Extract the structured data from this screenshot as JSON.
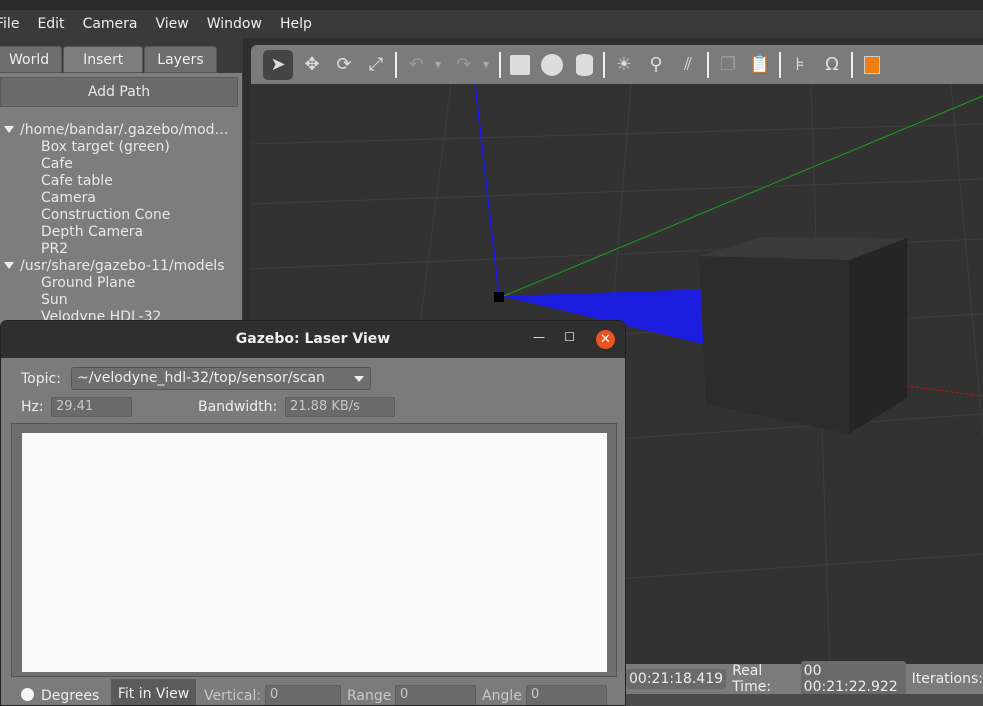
{
  "menu": [
    "File",
    "Edit",
    "Camera",
    "View",
    "Window",
    "Help"
  ],
  "left_panel": {
    "tabs": [
      "World",
      "Insert",
      "Layers"
    ],
    "active_tab": "Insert",
    "add_path": "Add Path",
    "tree": [
      {
        "path": "/home/bandar/.gazebo/mod…",
        "items": [
          "Box target (green)",
          "Cafe",
          "Cafe table",
          "Camera",
          "Construction Cone",
          "Depth Camera",
          "PR2"
        ]
      },
      {
        "path": "/usr/share/gazebo-11/models",
        "items": [
          "Ground Plane",
          "Sun",
          "Velodyne HDL-32"
        ]
      }
    ]
  },
  "toolbar": {
    "icons": [
      "select-arrow-icon",
      "translate-icon",
      "rotate-icon",
      "scale-icon",
      "undo-icon",
      "redo-icon",
      "box-icon",
      "sphere-icon",
      "cylinder-icon",
      "point-light-icon",
      "spot-light-icon",
      "directional-light-icon",
      "copy-icon",
      "paste-icon",
      "align-icon",
      "magnet-icon",
      "view-angle-icon"
    ]
  },
  "dialog": {
    "title": "Gazebo: Laser View",
    "topic_label": "Topic:",
    "topic": "~/velodyne_hdl-32/top/sensor/scan",
    "hz_label": "Hz:",
    "hz": "29.41",
    "bandwidth_label": "Bandwidth:",
    "bandwidth": "21.88 KB/s",
    "degrees": "Degrees",
    "fit": "Fit in View",
    "vertical_label": "Vertical:",
    "vertical": "0",
    "range_label": "Range",
    "range": "0",
    "angle_label": "Angle",
    "angle": "0"
  },
  "status": {
    "sim_time": "00:21:18.419",
    "real_time_label": "Real Time:",
    "real_time": "00 00:21:22.922",
    "iterations_label": "Iterations:"
  },
  "colors": {
    "accent_close": "#e95420",
    "laser": "#0000ff",
    "axis_x": "#ff0000",
    "axis_y": "#00ff00",
    "axis_z": "#0000ff"
  }
}
